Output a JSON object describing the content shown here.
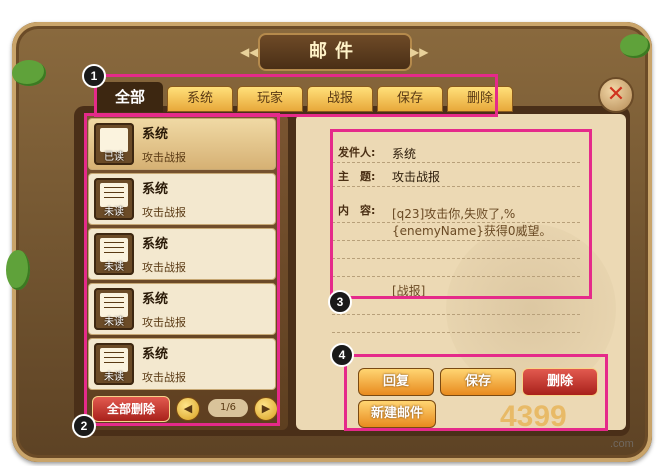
{
  "window": {
    "title": "邮件",
    "close_icon": "close-icon"
  },
  "tabs": [
    {
      "label": "全部",
      "active": true
    },
    {
      "label": "系统",
      "active": false
    },
    {
      "label": "玩家",
      "active": false
    },
    {
      "label": "战报",
      "active": false
    },
    {
      "label": "保存",
      "active": false
    },
    {
      "label": "删除",
      "active": false
    }
  ],
  "mail_list": [
    {
      "sender": "系统",
      "subject": "攻击战报",
      "status": "已读",
      "selected": true
    },
    {
      "sender": "系统",
      "subject": "攻击战报",
      "status": "未读",
      "selected": false
    },
    {
      "sender": "系统",
      "subject": "攻击战报",
      "status": "未读",
      "selected": false
    },
    {
      "sender": "系统",
      "subject": "攻击战报",
      "status": "未读",
      "selected": false
    },
    {
      "sender": "系统",
      "subject": "攻击战报",
      "status": "未读",
      "selected": false
    }
  ],
  "list_footer": {
    "delete_all": "全部删除",
    "page": "1/6"
  },
  "detail": {
    "sender_label": "发件人:",
    "sender_value": "系统",
    "subject_label": "主　题:",
    "subject_value": "攻击战报",
    "content_label": "内　容:",
    "content_value": "[q23]攻击你,失败了,%{enemyName}获得0威望。",
    "content_link": "[战报]"
  },
  "actions": {
    "reply": "回复",
    "save": "保存",
    "delete": "删除",
    "new_mail": "新建邮件"
  },
  "callouts": [
    "1",
    "2",
    "3",
    "4"
  ],
  "watermark": {
    "text": "4399",
    "domain": ".com"
  },
  "colors": {
    "callout": "#e52a8a",
    "tab_active_bg": "#3d2711",
    "button_red": "#c0342b",
    "button_orange": "#f0a030"
  }
}
